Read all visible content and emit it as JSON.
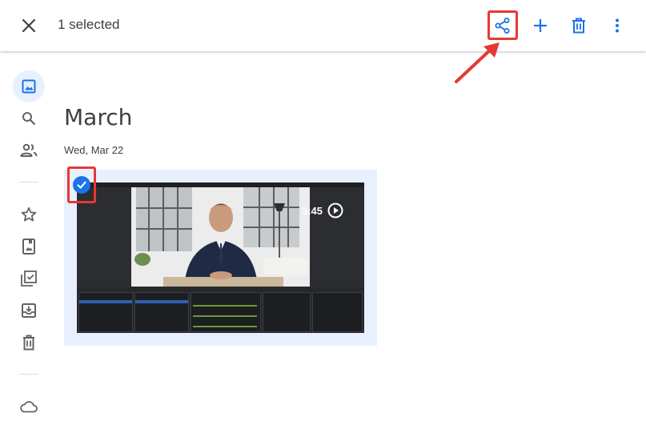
{
  "header": {
    "selection_text": "1 selected",
    "icons": {
      "close": "close-icon",
      "share": "share-icon",
      "add": "add-icon",
      "trash": "trash-icon",
      "more": "more-vert-icon"
    }
  },
  "sidebar": {
    "items": [
      {
        "icon": "photos-icon",
        "active": true
      },
      {
        "icon": "search-icon",
        "active": false
      },
      {
        "icon": "sharing-icon",
        "active": false
      },
      {
        "icon": "favorites-icon",
        "active": false
      },
      {
        "icon": "albums-icon",
        "active": false
      },
      {
        "icon": "utilities-icon",
        "active": false
      },
      {
        "icon": "archive-icon",
        "active": false
      },
      {
        "icon": "trash-icon",
        "active": false
      },
      {
        "icon": "storage-cloud-icon",
        "active": false
      }
    ]
  },
  "main": {
    "month_title": "March",
    "date_label": "Wed, Mar 22",
    "media": {
      "type": "video",
      "duration": "3:45",
      "selected": true
    }
  },
  "colors": {
    "accent": "#1a73e8",
    "icon_gray": "#5f6368",
    "highlight_red": "#e53935",
    "selection_bg": "#e8f0fe"
  }
}
